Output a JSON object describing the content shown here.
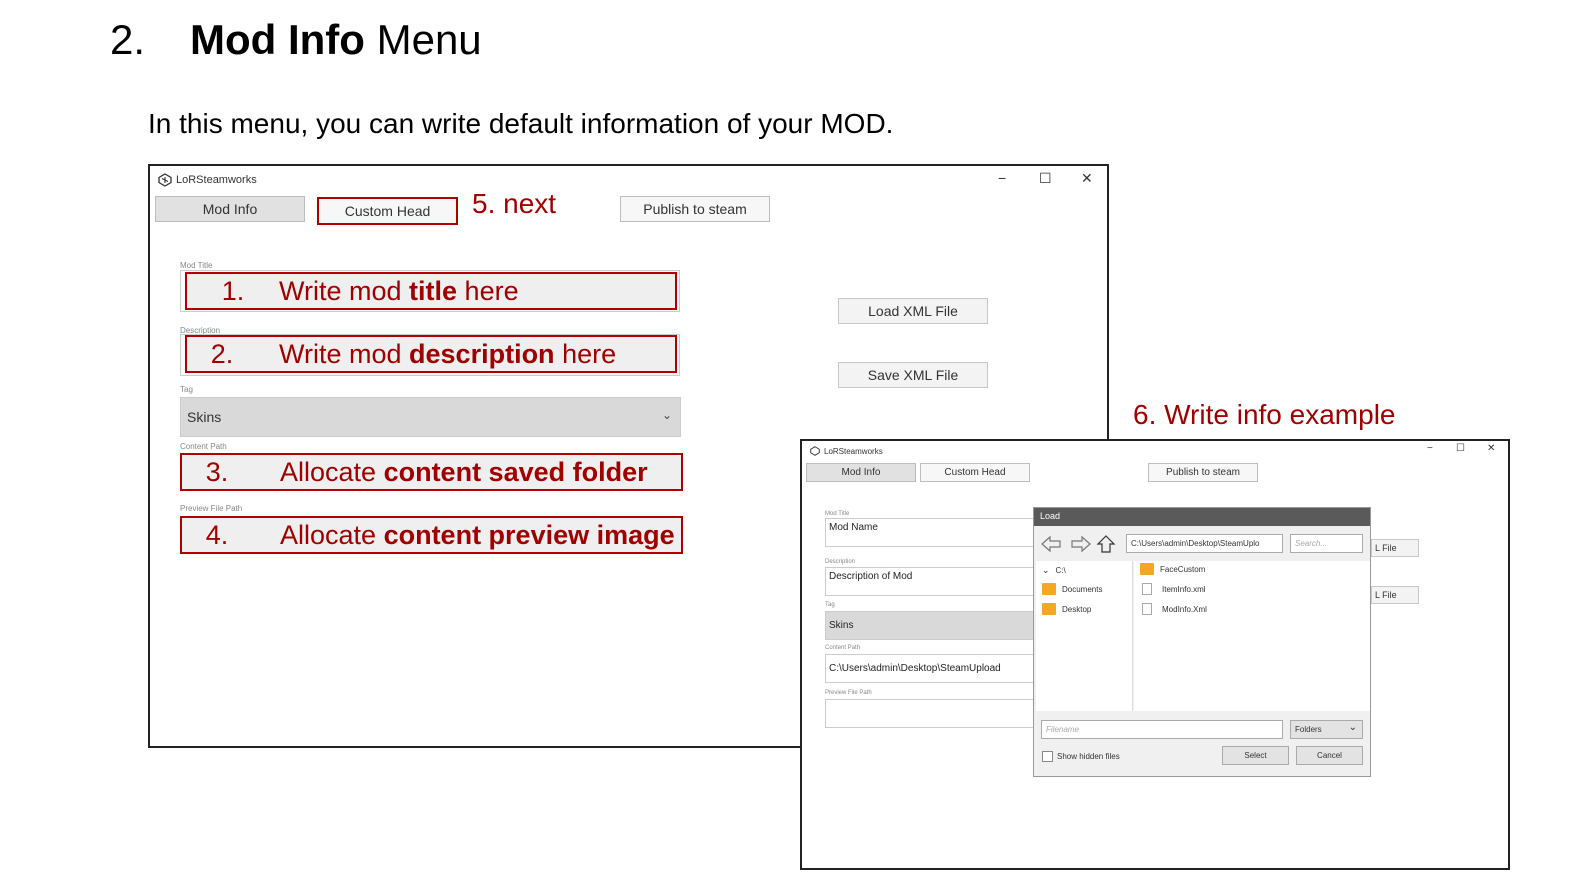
{
  "doc": {
    "section_number": "2.",
    "title_bold": "Mod Info",
    "title_rest": " Menu",
    "intro": "In this menu, you can write default information of your MOD."
  },
  "window1": {
    "title": "LoRSteamworks",
    "controls": {
      "minimize": "−",
      "maximize": "☐",
      "close": "✕"
    },
    "tabs": {
      "mod_info": "Mod Info",
      "custom_head": "Custom Head",
      "publish": "Publish to steam"
    },
    "note_next": "5. next",
    "labels": {
      "mod_title": "Mod Title",
      "description": "Description",
      "tag": "Tag",
      "content_path": "Content Path",
      "preview_path": "Preview File Path"
    },
    "annotations": {
      "a1": {
        "num": "1.",
        "pre": "Write mod ",
        "bold": "title",
        "post": " here"
      },
      "a2": {
        "num": "2.",
        "pre": "Write mod ",
        "bold": "description",
        "post": " here"
      },
      "a3": {
        "num": "3.",
        "pre": "Allocate ",
        "bold": "content saved folder",
        "post": ""
      },
      "a4": {
        "num": "4.",
        "pre": "Allocate ",
        "bold": "content preview image",
        "post": ""
      }
    },
    "tag_value": "Skins",
    "buttons": {
      "load_xml": "Load XML File",
      "save_xml": "Save XML File"
    }
  },
  "note_example": "6.  Write info example",
  "window2": {
    "title": "LoRSteamworks",
    "controls": {
      "minimize": "−",
      "maximize": "☐",
      "close": "✕"
    },
    "tabs": {
      "mod_info": "Mod Info",
      "custom_head": "Custom Head",
      "publish": "Publish to steam"
    },
    "labels": {
      "mod_title": "Mod Title",
      "description": "Description",
      "tag": "Tag",
      "content_path": "Content Path",
      "preview_path": "Preview File Path"
    },
    "values": {
      "mod_title": "Mod Name",
      "description": "Description of Mod",
      "tag": "Skins",
      "content_path": "C:\\Users\\admin\\Desktop\\SteamUpload"
    },
    "side_buttons": {
      "load_xml_partial": "L File",
      "save_xml_partial": "L File"
    },
    "dialog": {
      "title": "Load",
      "path": "C:\\Users\\admin\\Desktop\\SteamUplo",
      "search_placeholder": "Search...",
      "left_items": [
        "C:\\",
        "Documents",
        "Desktop"
      ],
      "right_items": [
        "FaceCustom",
        "ItemInfo.xml",
        "ModInfo.Xml"
      ],
      "filename_placeholder": "Filename",
      "filter": "Folders",
      "show_hidden": "Show hidden files",
      "select": "Select",
      "cancel": "Cancel"
    }
  }
}
